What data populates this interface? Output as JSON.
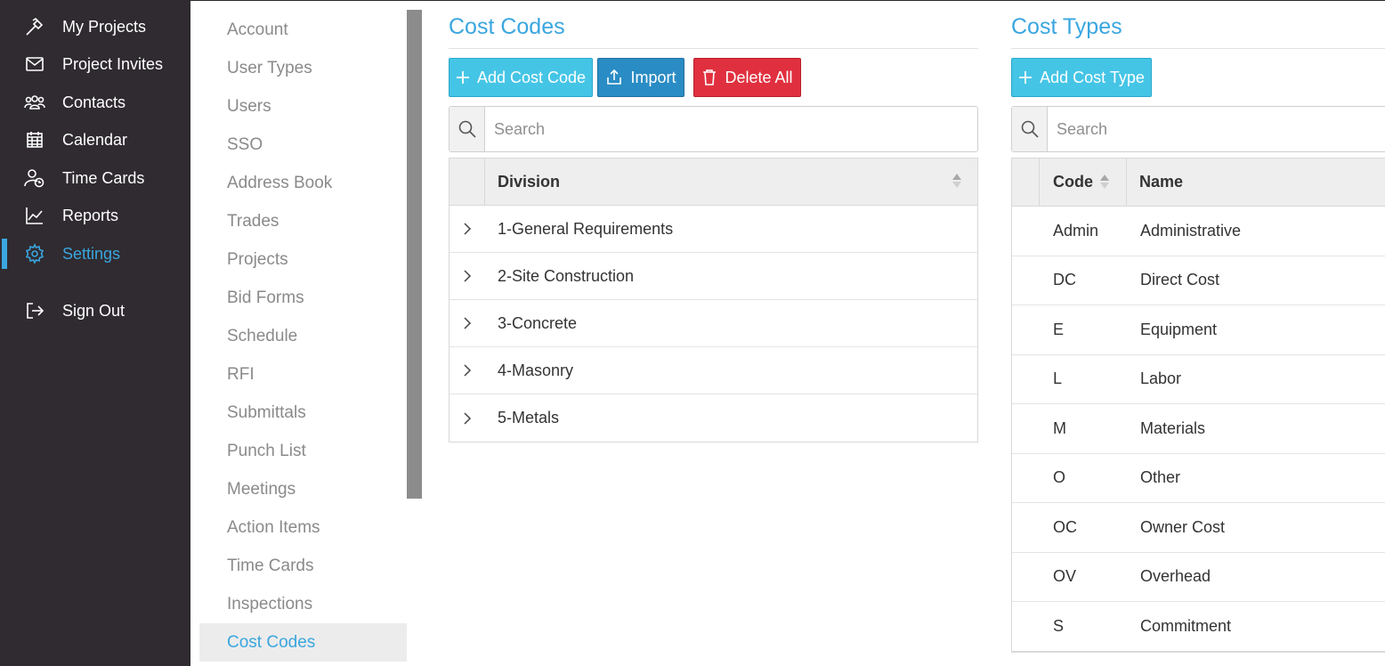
{
  "nav": {
    "items": [
      {
        "label": "My Projects",
        "icon": "hammer-icon"
      },
      {
        "label": "Project Invites",
        "icon": "envelope-icon"
      },
      {
        "label": "Contacts",
        "icon": "people-icon"
      },
      {
        "label": "Calendar",
        "icon": "calendar-icon"
      },
      {
        "label": "Time Cards",
        "icon": "user-clock-icon"
      },
      {
        "label": "Reports",
        "icon": "line-chart-icon"
      },
      {
        "label": "Settings",
        "icon": "gear-icon",
        "active": true
      },
      {
        "label": "Sign Out",
        "icon": "sign-out-icon"
      }
    ]
  },
  "settings_menu": {
    "items": [
      "Account",
      "User Types",
      "Users",
      "SSO",
      "Address Book",
      "Trades",
      "Projects",
      "Bid Forms",
      "Schedule",
      "RFI",
      "Submittals",
      "Punch List",
      "Meetings",
      "Action Items",
      "Time Cards",
      "Inspections",
      "Cost Codes"
    ],
    "active": "Cost Codes"
  },
  "cost_codes": {
    "title": "Cost Codes",
    "add_label": "Add Cost Code",
    "import_label": "Import",
    "delete_all_label": "Delete All",
    "search_placeholder": "Search",
    "column_header": "Division",
    "divisions": [
      "1-General Requirements",
      "2-Site Construction",
      "3-Concrete",
      "4-Masonry",
      "5-Metals"
    ]
  },
  "cost_types": {
    "title": "Cost Types",
    "add_label": "Add Cost Type",
    "search_placeholder": "Search",
    "code_header": "Code",
    "name_header": "Name",
    "rows": [
      {
        "code": "Admin",
        "name": "Administrative"
      },
      {
        "code": "DC",
        "name": "Direct Cost"
      },
      {
        "code": "E",
        "name": "Equipment"
      },
      {
        "code": "L",
        "name": "Labor"
      },
      {
        "code": "M",
        "name": "Materials"
      },
      {
        "code": "O",
        "name": "Other"
      },
      {
        "code": "OC",
        "name": "Owner Cost"
      },
      {
        "code": "OV",
        "name": "Overhead"
      },
      {
        "code": "S",
        "name": "Commitment"
      }
    ]
  },
  "colors": {
    "sidebar_bg": "#2f2b30",
    "accent": "#3aa6e0",
    "button_cyan": "#45c5e6",
    "button_blue": "#2a8cc4",
    "button_red": "#e0303f"
  }
}
